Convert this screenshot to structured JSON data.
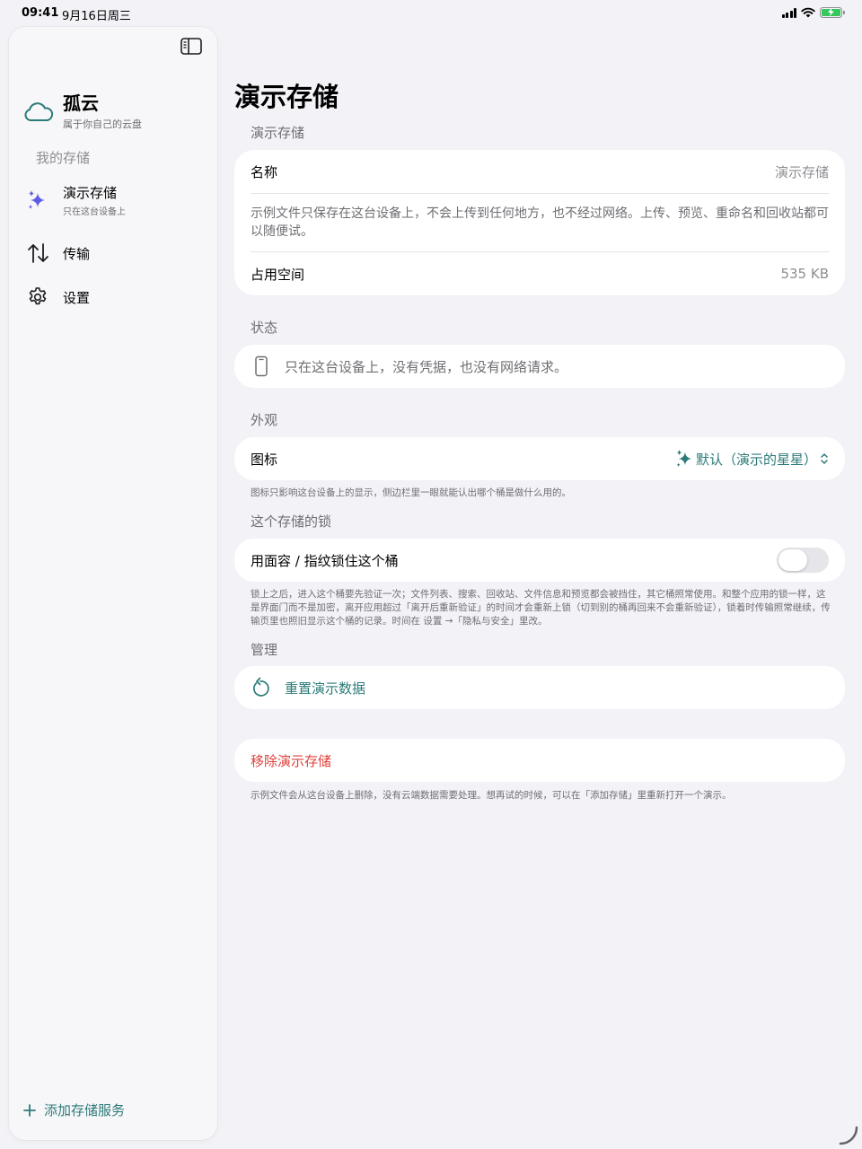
{
  "status_bar": {
    "time": "09:41",
    "date": "9月16日周三",
    "battery_color": "#34c759"
  },
  "sidebar": {
    "toggle_icon": "sidebar-toggle-icon",
    "brand": {
      "title": "孤云",
      "subtitle": "属于你自己的云盘",
      "icon": "cloud-icon"
    },
    "section_label": "我的存储",
    "storage_item": {
      "label": "演示存储",
      "sub": "只在这台设备上",
      "icon": "sparkles-icon",
      "icon_color": "#5e5ce6"
    },
    "nav": [
      {
        "label": "传输",
        "icon": "transfer-arrows-icon"
      },
      {
        "label": "设置",
        "icon": "gear-icon"
      }
    ],
    "add_service": "添加存储服务"
  },
  "main": {
    "title": "演示存储",
    "groups": {
      "storage": {
        "label": "演示存储",
        "name_label": "名称",
        "name_value": "演示存储",
        "description": "示例文件只保存在这台设备上，不会上传到任何地方，也不经过网络。上传、预览、重命名和回收站都可以随便试。",
        "usage_label": "占用空间",
        "usage_value": "535 KB"
      },
      "status": {
        "label": "状态",
        "icon": "phone-icon",
        "text": "只在这台设备上，没有凭据，也没有网络请求。"
      },
      "appearance": {
        "label": "外观",
        "icon_label": "图标",
        "icon_value": "默认（演示的星星）",
        "footnote": "图标只影响这台设备上的显示，侧边栏里一眼就能认出哪个桶是做什么用的。"
      },
      "lock": {
        "label": "这个存储的锁",
        "toggle_label": "用面容 / 指纹锁住这个桶",
        "toggle_on": false,
        "footnote": "锁上之后，进入这个桶要先验证一次；文件列表、搜索、回收站、文件信息和预览都会被挡住，其它桶照常使用。和整个应用的锁一样，这是界面门而不是加密，离开应用超过「离开后重新验证」的时间才会重新上锁（切到别的桶再回来不会重新验证），锁着时传输照常继续，传输页里也照旧显示这个桶的记录。时间在 设置 →「隐私与安全」里改。"
      },
      "manage": {
        "label": "管理",
        "reset_label": "重置演示数据",
        "reset_icon": "reset-arrow-icon"
      },
      "remove": {
        "label": "移除演示存储",
        "footnote": "示例文件会从这台设备上删除，没有云端数据需要处理。想再试的时候，可以在「添加存储」里重新打开一个演示。"
      }
    }
  },
  "colors": {
    "accent": "#2b7a78",
    "danger": "#e0403a",
    "background": "#f2f2f7"
  }
}
